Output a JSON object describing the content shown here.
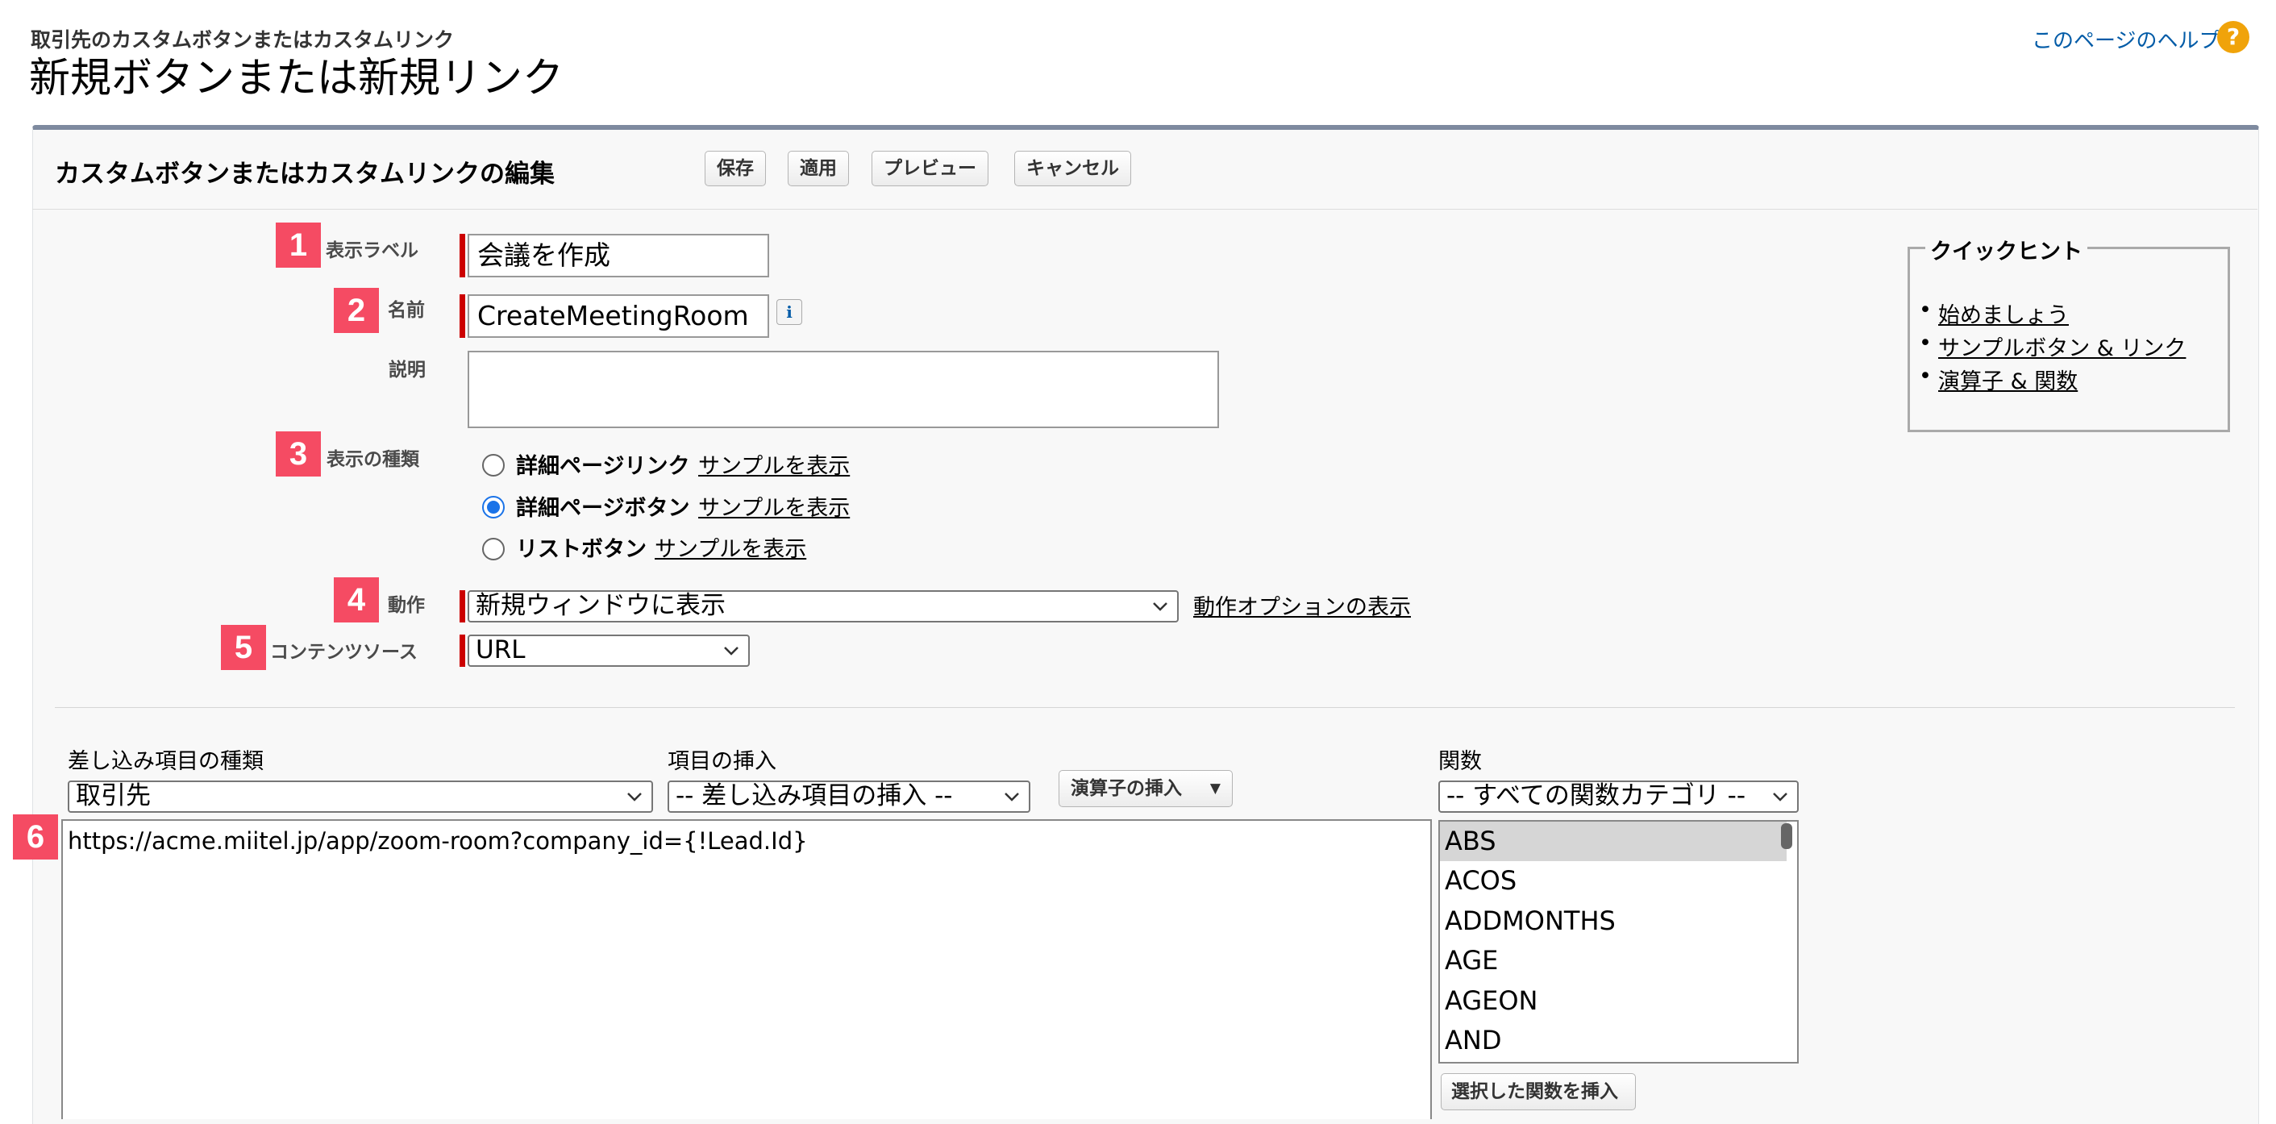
{
  "header": {
    "subtitle": "取引先のカスタムボタンまたはカスタムリンク",
    "title": "新規ボタンまたは新規リンク",
    "help_link": "このページのヘルプ",
    "help_icon": "?"
  },
  "panel": {
    "title": "カスタムボタンまたはカスタムリンクの編集",
    "buttons": {
      "save": "保存",
      "apply": "適用",
      "preview": "プレビュー",
      "cancel": "キャンセル"
    }
  },
  "badges": [
    "1",
    "2",
    "3",
    "4",
    "5",
    "6"
  ],
  "form": {
    "label_field": {
      "label": "表示ラベル",
      "value": "会議を作成"
    },
    "name_field": {
      "label": "名前",
      "value": "CreateMeetingRoom",
      "info_icon": "i"
    },
    "description": {
      "label": "説明",
      "value": ""
    },
    "display_type": {
      "label": "表示の種類",
      "options": [
        {
          "label": "詳細ページリンク",
          "sample": "サンプルを表示",
          "selected": false
        },
        {
          "label": "詳細ページボタン",
          "sample": "サンプルを表示",
          "selected": true
        },
        {
          "label": "リストボタン",
          "sample": "サンプルを表示",
          "selected": false
        }
      ]
    },
    "behavior": {
      "label": "動作",
      "value": "新規ウィンドウに表示",
      "options_link": "動作オプションの表示"
    },
    "content_source": {
      "label": "コンテンツソース",
      "value": "URL"
    }
  },
  "quick_hints": {
    "title": "クイックヒント",
    "items": [
      "始めましょう",
      "サンプルボタン & リンク",
      "演算子 & 関数"
    ]
  },
  "formula_editor": {
    "merge_type_label": "差し込み項目の種類",
    "merge_type_value": "取引先",
    "insert_field_label": "項目の挿入",
    "insert_field_value": "-- 差し込み項目の挿入 --",
    "insert_operator": "演算子の挿入",
    "functions_label": "関数",
    "functions_category": "-- すべての関数カテゴリ --",
    "functions": [
      "ABS",
      "ACOS",
      "ADDMONTHS",
      "AGE",
      "AGEON",
      "AND"
    ],
    "insert_function_button": "選択した関数を挿入",
    "formula_text": "https://acme.miitel.jp/app/zoom-room?company_id={!Lead.Id}"
  },
  "colors": {
    "badge": "#f54b63",
    "required": "#cc0000",
    "link": "#015ba7",
    "panel_border": "#7e8a9f"
  }
}
